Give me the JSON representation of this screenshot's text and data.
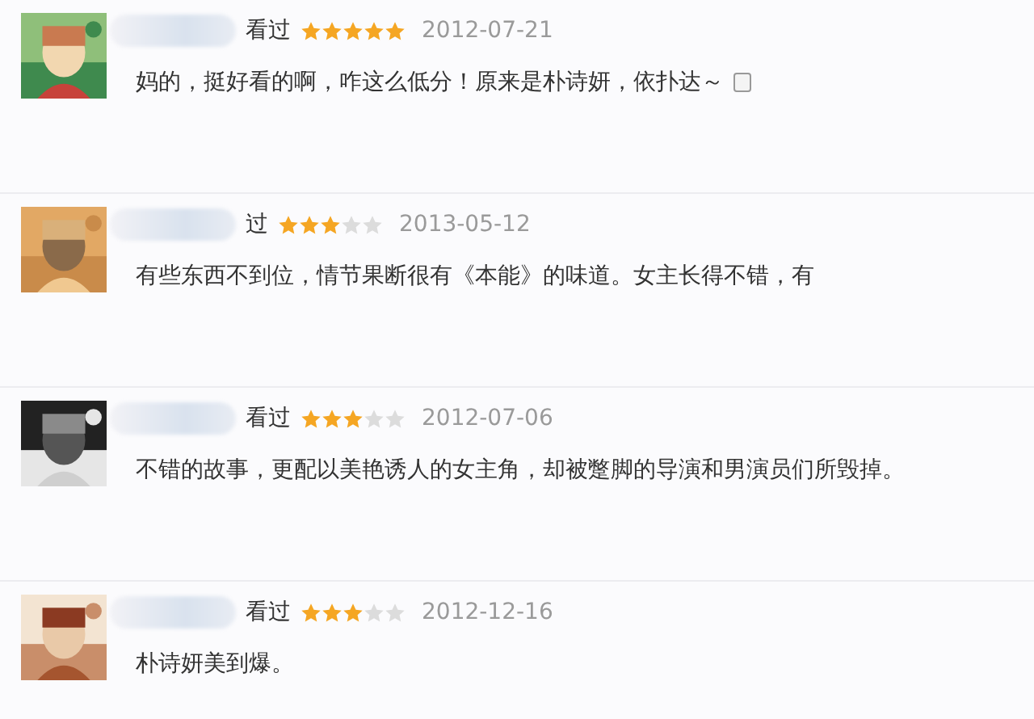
{
  "reviews": [
    {
      "status": "看过",
      "stars": 5,
      "date": "2012-07-21",
      "comment": "妈的，挺好看的啊，咋这么低分！原来是朴诗妍，依扑达～",
      "note_icon": true
    },
    {
      "status": "过",
      "stars": 3,
      "date": "2013-05-12",
      "comment": "有些东西不到位，情节果断很有《本能》的味道。女主长得不错，有",
      "note_icon": false
    },
    {
      "status": "看过",
      "stars": 3,
      "date": "2012-07-06",
      "comment": "不错的故事，更配以美艳诱人的女主角，却被蹩脚的导演和男演员们所毁掉。",
      "note_icon": false
    },
    {
      "status": "看过",
      "stars": 3,
      "date": "2012-12-16",
      "comment": "朴诗妍美到爆。",
      "note_icon": false
    }
  ]
}
